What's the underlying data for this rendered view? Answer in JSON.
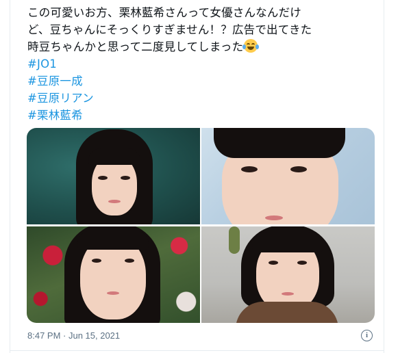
{
  "tweet": {
    "text_lines": [
      "この可愛いお方、栗林藍希さんって女優さんなんだけ",
      "ど、豆ちゃんにそっくりすぎません！？広告で出てきた",
      "時豆ちゃんかと思って二度見してしまった"
    ],
    "emoji": "face-with-tears-of-joy",
    "hashtags": [
      "#JO1",
      "#豆原一成",
      "#豆原リアン",
      "#栗林藍希"
    ],
    "timestamp": "8:47 PM · Jun 15, 2021"
  },
  "media": {
    "photos": [
      {
        "name": "photo-1",
        "description_icon": "portrait-photo"
      },
      {
        "name": "photo-2",
        "description_icon": "portrait-photo"
      },
      {
        "name": "photo-3",
        "description_icon": "portrait-photo"
      },
      {
        "name": "photo-4",
        "description_icon": "portrait-photo"
      }
    ]
  },
  "icons": {
    "info": "info-icon"
  },
  "colors": {
    "link": "#1b95e0",
    "meta": "#5b7083",
    "text": "#0f1419"
  }
}
